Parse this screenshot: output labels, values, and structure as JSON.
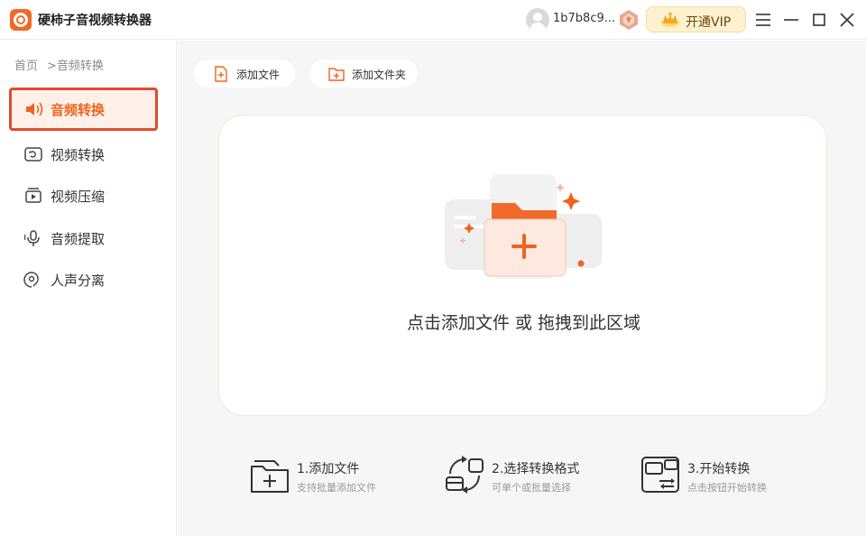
{
  "app": {
    "title": "硬柿子音视频转换器",
    "username": "1b7b8c9...",
    "vip_label": "开通VIP",
    "accent_color": "#f0631e",
    "active_border_color": "#e24b2c"
  },
  "sidebar": {
    "breadcrumb_home": "首页",
    "breadcrumb_current": ">音频转换",
    "items": [
      {
        "label": "音频转换",
        "icon": "audio-convert-icon",
        "active": true
      },
      {
        "label": "视频转换",
        "icon": "video-convert-icon",
        "active": false
      },
      {
        "label": "视频压缩",
        "icon": "video-compress-icon",
        "active": false
      },
      {
        "label": "音频提取",
        "icon": "audio-extract-icon",
        "active": false
      },
      {
        "label": "人声分离",
        "icon": "vocal-separate-icon",
        "active": false
      }
    ]
  },
  "toolbar": {
    "add_file": "添加文件",
    "add_folder": "添加文件夹"
  },
  "dropzone": {
    "text": "点击添加文件 或 拖拽到此区域"
  },
  "steps": [
    {
      "title": "1.添加文件",
      "desc": "支持批量添加文件",
      "icon": "add-file-step-icon"
    },
    {
      "title": "2.选择转换格式",
      "desc": "可单个或批量选择",
      "icon": "format-step-icon"
    },
    {
      "title": "3.开始转换",
      "desc": "点击按钮开始转换",
      "icon": "convert-step-icon"
    }
  ]
}
